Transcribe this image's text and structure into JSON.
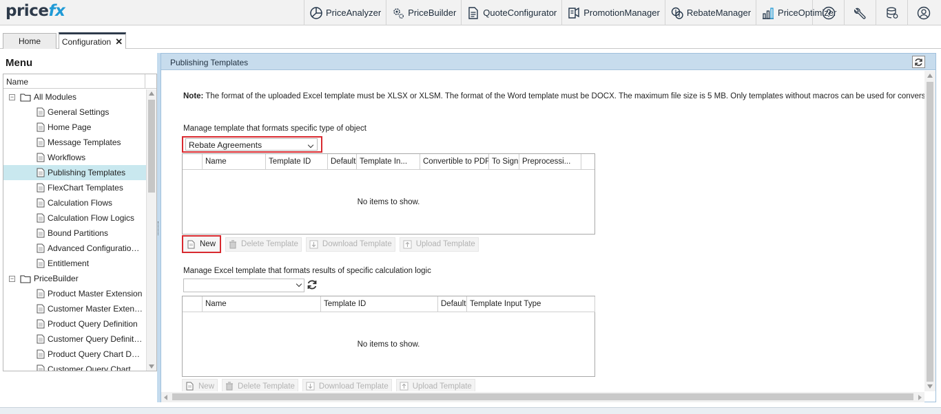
{
  "logo": {
    "part1": "price",
    "part2": "fx"
  },
  "apps": [
    {
      "label": "PriceAnalyzer",
      "icon": "price-analyzer-icon"
    },
    {
      "label": "PriceBuilder",
      "icon": "price-builder-icon"
    },
    {
      "label": "QuoteConfigurator",
      "icon": "quote-configurator-icon"
    },
    {
      "label": "PromotionManager",
      "icon": "promotion-manager-icon"
    },
    {
      "label": "RebateManager",
      "icon": "rebate-manager-icon"
    },
    {
      "label": "PriceOptimizer",
      "icon": "price-optimizer-icon"
    }
  ],
  "utils": [
    "help-icon",
    "wrench-icon",
    "database-icon",
    "user-icon"
  ],
  "tabs": {
    "home": "Home",
    "configuration": "Configuration",
    "close": "✕"
  },
  "menu": {
    "title": "Menu",
    "column": "Name",
    "items": [
      {
        "label": "All Modules",
        "type": "folder",
        "expander": "−"
      },
      {
        "label": "General Settings",
        "type": "doc"
      },
      {
        "label": "Home Page",
        "type": "doc"
      },
      {
        "label": "Message Templates",
        "type": "doc"
      },
      {
        "label": "Workflows",
        "type": "doc"
      },
      {
        "label": "Publishing Templates",
        "type": "doc",
        "selected": true
      },
      {
        "label": "FlexChart Templates",
        "type": "doc"
      },
      {
        "label": "Calculation Flows",
        "type": "doc"
      },
      {
        "label": "Calculation Flow Logics",
        "type": "doc"
      },
      {
        "label": "Bound Partitions",
        "type": "doc"
      },
      {
        "label": "Advanced Configuration ...",
        "type": "doc"
      },
      {
        "label": "Entitlement",
        "type": "doc"
      },
      {
        "label": "PriceBuilder",
        "type": "folder",
        "expander": "−"
      },
      {
        "label": "Product Master Extension",
        "type": "doc"
      },
      {
        "label": "Customer Master Extension",
        "type": "doc"
      },
      {
        "label": "Product Query Definition",
        "type": "doc"
      },
      {
        "label": "Customer Query Definition",
        "type": "doc"
      },
      {
        "label": "Product Query Chart Defi...",
        "type": "doc"
      },
      {
        "label": "Customer Query Chart De...",
        "type": "doc"
      }
    ]
  },
  "panel": {
    "title": "Publishing Templates",
    "note_label": "Note:",
    "note_text": " The format of the uploaded Excel template must be XLSX or XLSM. The format of the Word template must be DOCX. The maximum file size is 5 MB. Only templates without macros can be used for conversion to PDF.",
    "section1": {
      "label": "Manage template that formats specific type of object",
      "select_value": "Rebate Agreements",
      "columns": [
        "Name",
        "Template ID",
        "Default",
        "Template In...",
        "Convertible to PDF",
        "To Sign",
        "Preprocessi..."
      ],
      "empty": "No items to show.",
      "buttons": {
        "new": "New",
        "delete": "Delete Template",
        "download": "Download Template",
        "upload": "Upload Template"
      }
    },
    "section2": {
      "label": "Manage Excel template that formats results of specific calculation logic",
      "select_value": "",
      "columns": [
        "Name",
        "Template ID",
        "Default",
        "Template Input Type"
      ],
      "empty": "No items to show.",
      "buttons": {
        "new": "New",
        "delete": "Delete Template",
        "download": "Download Template",
        "upload": "Upload Template"
      }
    }
  },
  "colors": {
    "accent": "#1f9ad6",
    "highlight": "#d8292f",
    "selected_row": "#c9e8ef",
    "panel_header": "#c7dced"
  }
}
